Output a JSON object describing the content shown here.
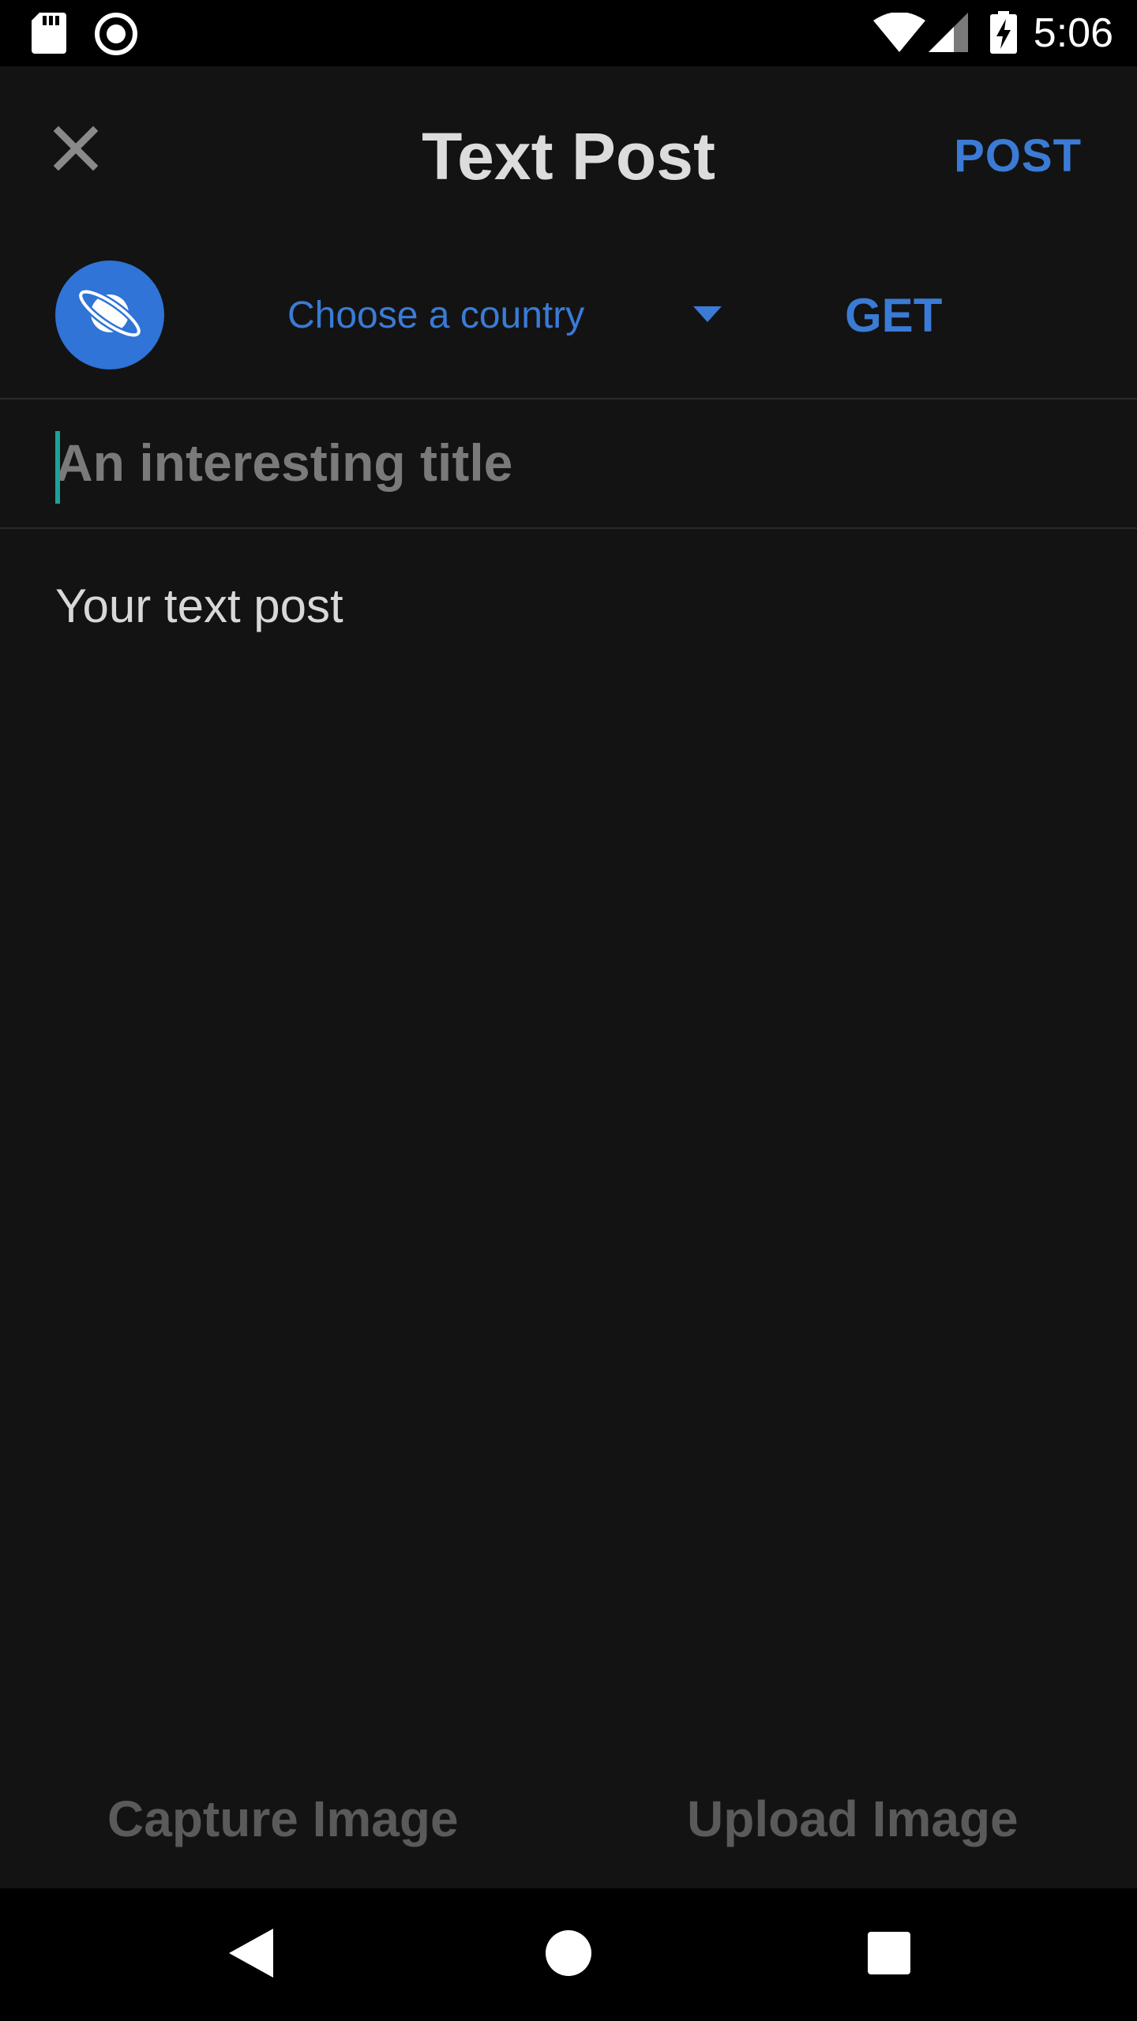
{
  "status_bar": {
    "time": "5:06",
    "icons": [
      "sd-card-icon",
      "record-icon",
      "wifi-icon",
      "cell-signal-icon",
      "battery-charging-icon"
    ]
  },
  "toolbar": {
    "close_icon": "close-icon",
    "title": "Text Post",
    "post_label": "POST"
  },
  "community": {
    "avatar_icon": "planet-icon",
    "country_select_label": "Choose a country",
    "get_label": "GET"
  },
  "title_field": {
    "placeholder": "An interesting title",
    "value": ""
  },
  "body_field": {
    "placeholder": "Your text post",
    "value": ""
  },
  "actions": {
    "capture_label": "Capture Image",
    "upload_label": "Upload Image"
  },
  "nav_bar": {
    "icons": [
      "back-icon",
      "home-icon",
      "recents-icon"
    ]
  },
  "colors": {
    "accent": "#3a7bd5",
    "background": "#131313",
    "cursor": "#1aa39a",
    "disabled_text": "#5a5a5a"
  }
}
